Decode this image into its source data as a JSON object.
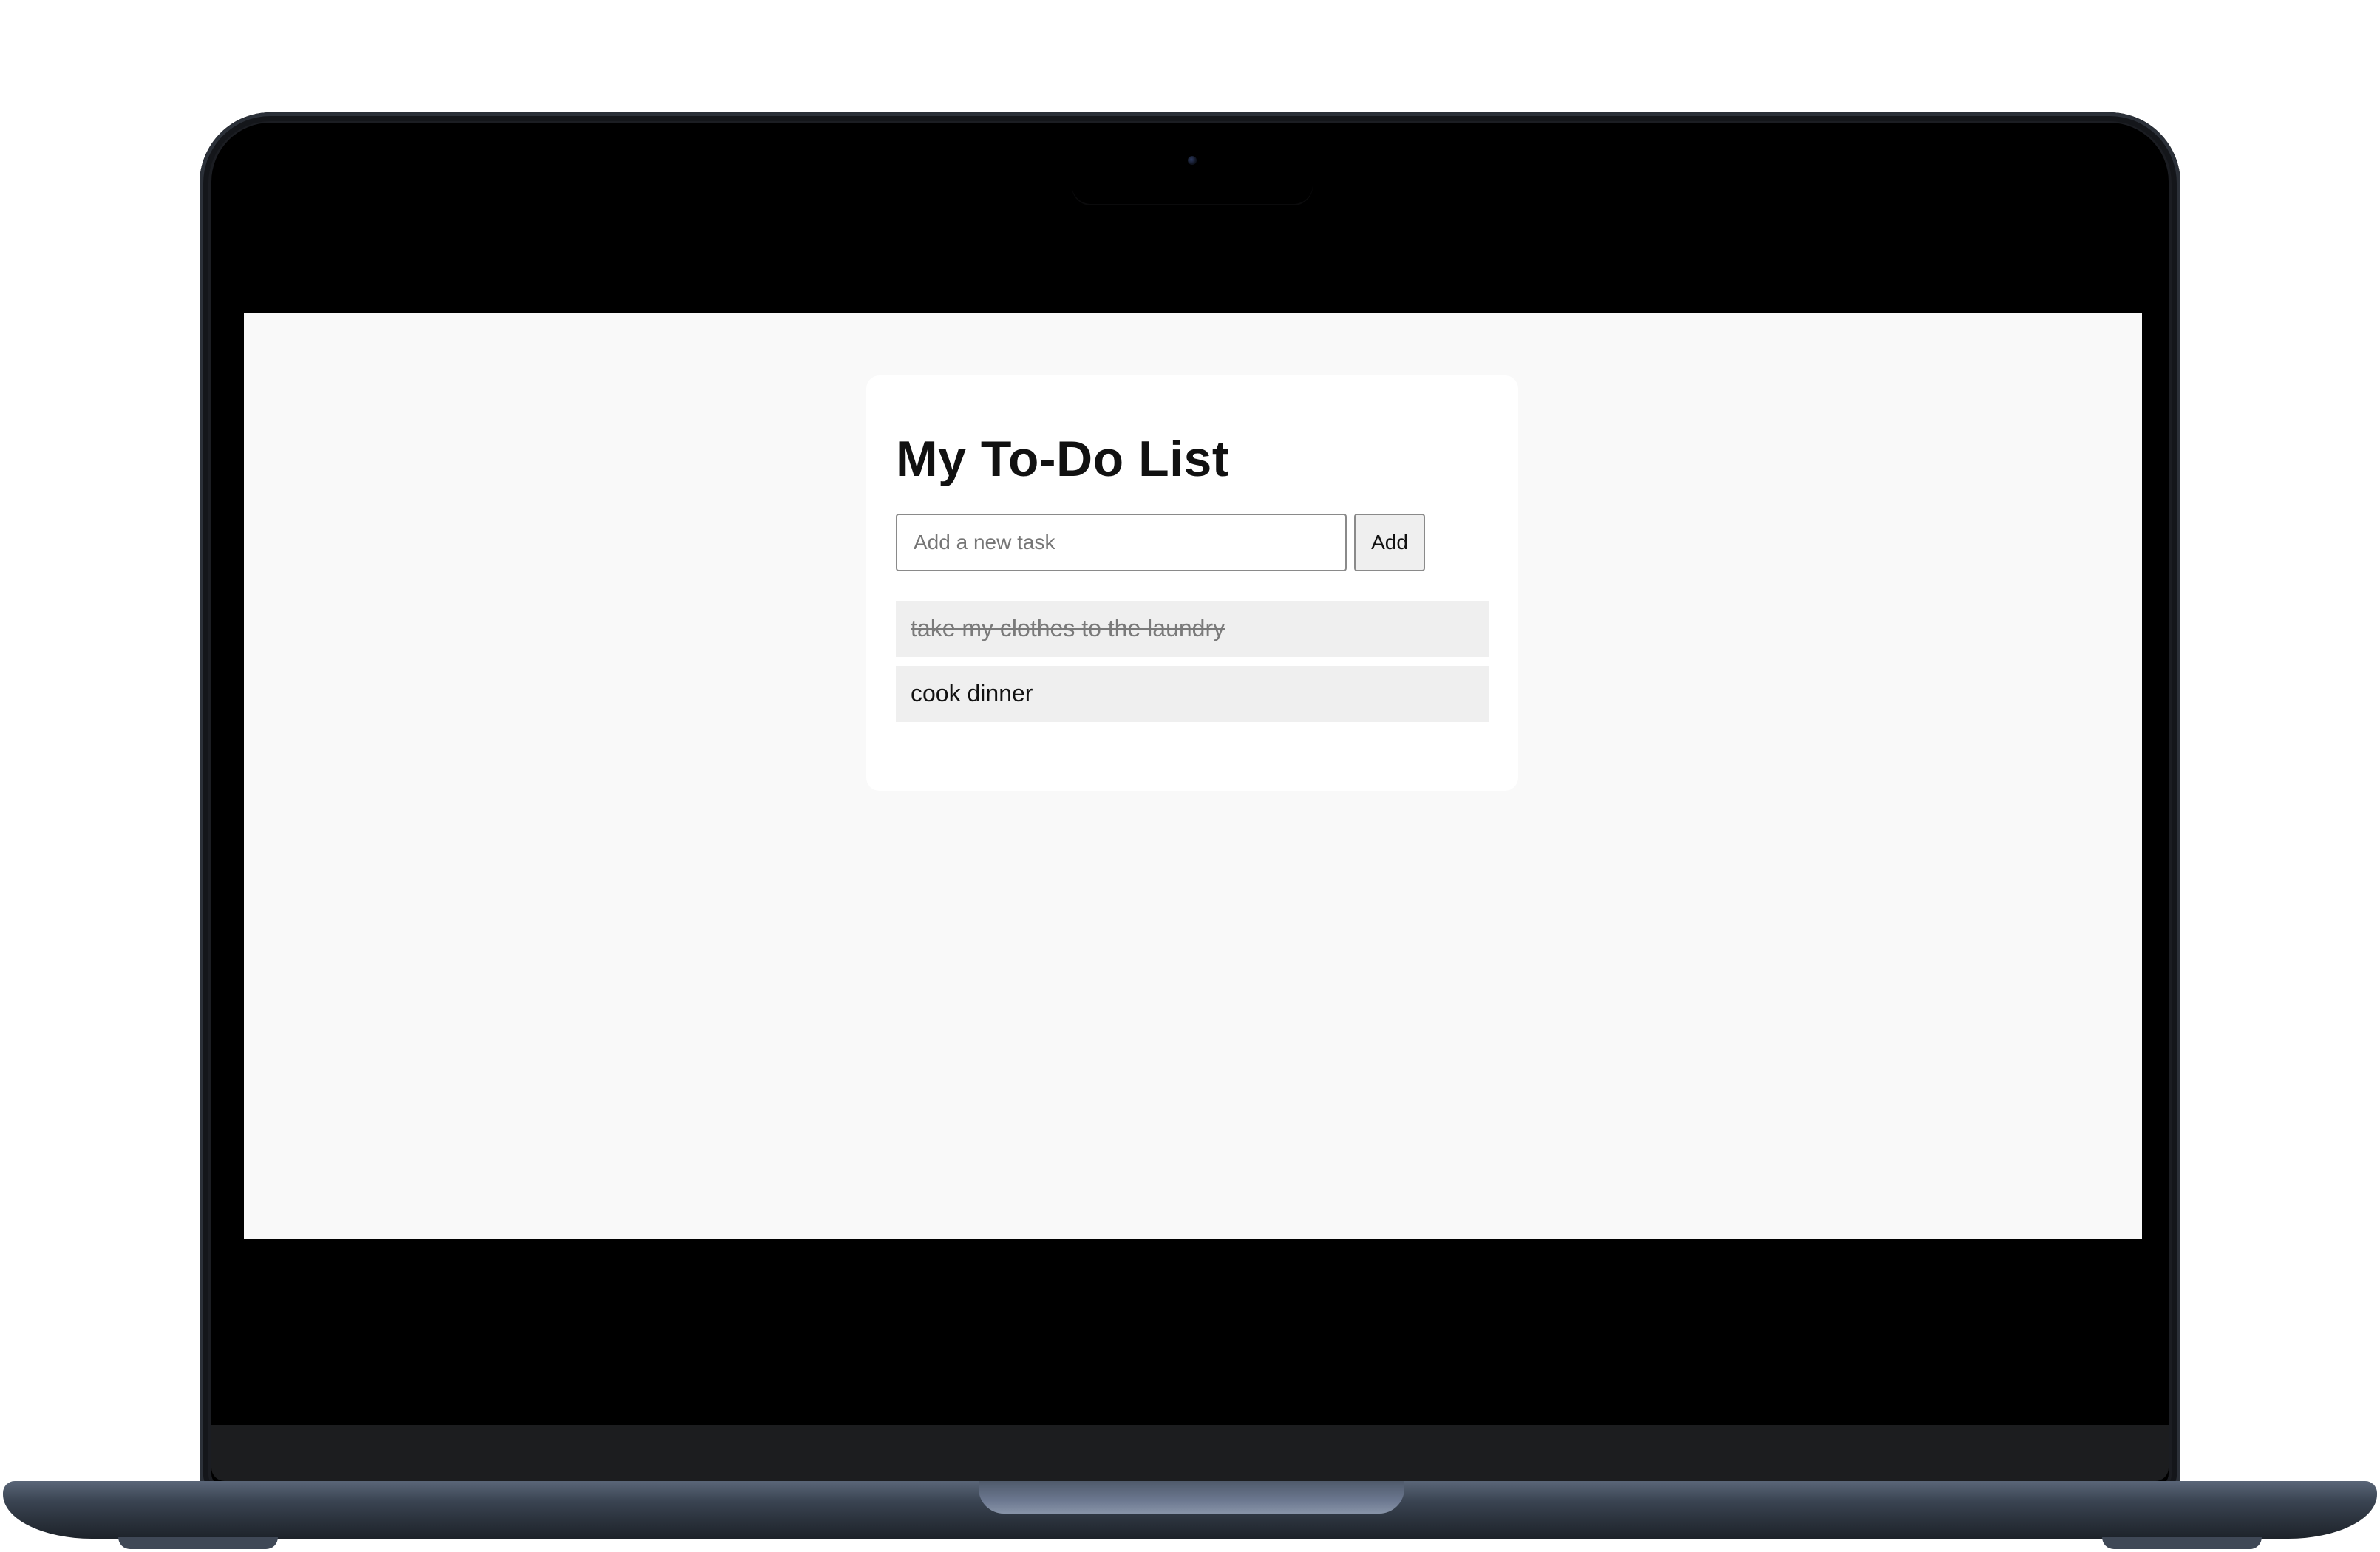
{
  "app": {
    "title": "My To-Do List"
  },
  "new_task": {
    "placeholder": "Add a new task",
    "value": "",
    "add_label": "Add"
  },
  "tasks": [
    {
      "text": "take my clothes to the laundry",
      "completed": true
    },
    {
      "text": "cook dinner",
      "completed": false
    }
  ],
  "colors": {
    "page_background": "#f9f9f9",
    "card_background": "#ffffff",
    "task_background": "#efefef",
    "completed_text": "#7a7a7a",
    "laptop_body": "#2a313b"
  }
}
